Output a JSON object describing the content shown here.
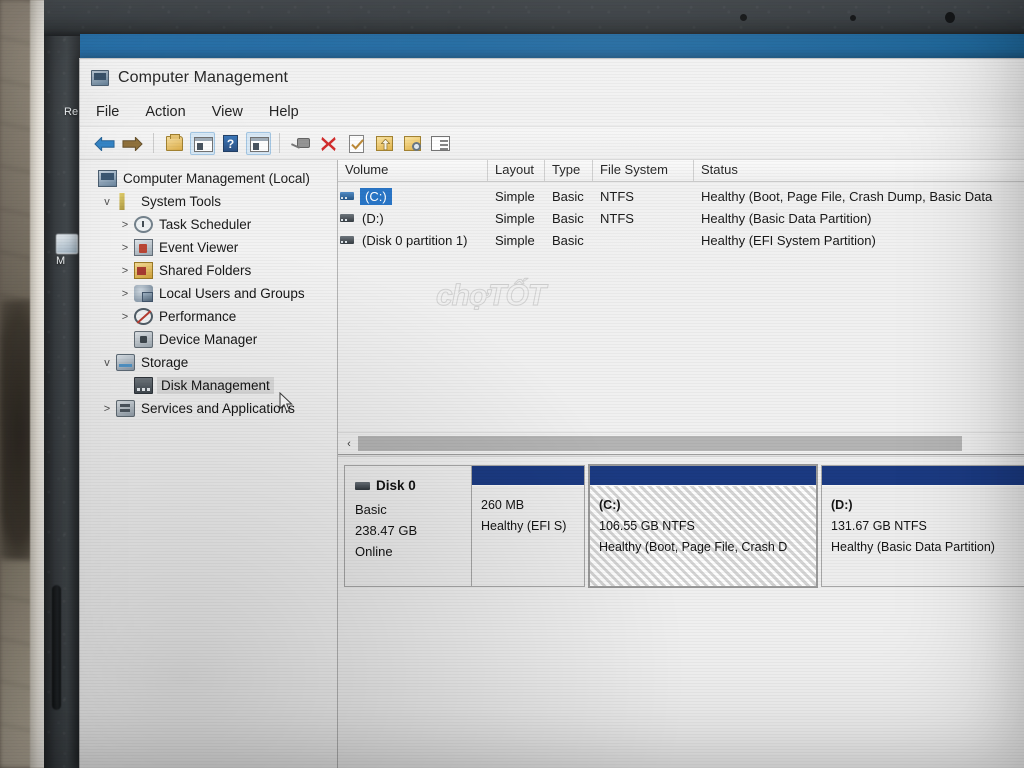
{
  "window": {
    "title": "Computer Management",
    "title_icon": "computer-icon"
  },
  "menu": {
    "items": [
      "File",
      "Action",
      "View",
      "Help"
    ]
  },
  "toolbar": {
    "buttons": [
      {
        "name": "back-icon",
        "label": "Back"
      },
      {
        "name": "forward-icon",
        "label": "Forward"
      },
      {
        "name": "up-one-level-icon",
        "label": "Up One Level"
      },
      {
        "name": "show-console-tree-icon",
        "label": "Show/Hide Console Tree"
      },
      {
        "name": "help-icon",
        "label": "Help"
      },
      {
        "name": "properties-icon",
        "label": "Properties"
      },
      {
        "name": "rescan-disks-icon",
        "label": "Rescan Disks"
      },
      {
        "name": "delete-icon",
        "label": "Delete"
      },
      {
        "name": "verify-icon",
        "label": "Verify"
      },
      {
        "name": "export-list-icon",
        "label": "Export List"
      },
      {
        "name": "find-icon",
        "label": "Find"
      },
      {
        "name": "list-view-icon",
        "label": "List View"
      }
    ]
  },
  "tree": {
    "items": [
      {
        "label": "Computer Management (Local)",
        "icon": "computer-icon",
        "indent": 0,
        "chevron": "",
        "selected": false
      },
      {
        "label": "System Tools",
        "icon": "tools-icon",
        "indent": 1,
        "chevron": "v",
        "selected": false
      },
      {
        "label": "Task Scheduler",
        "icon": "clock-icon",
        "indent": 2,
        "chevron": ">",
        "selected": false
      },
      {
        "label": "Event Viewer",
        "icon": "event-log-icon",
        "indent": 2,
        "chevron": ">",
        "selected": false
      },
      {
        "label": "Shared Folders",
        "icon": "shared-folder-icon",
        "indent": 2,
        "chevron": ">",
        "selected": false
      },
      {
        "label": "Local Users and Groups",
        "icon": "users-icon",
        "indent": 2,
        "chevron": ">",
        "selected": false
      },
      {
        "label": "Performance",
        "icon": "performance-icon",
        "indent": 2,
        "chevron": ">",
        "selected": false
      },
      {
        "label": "Device Manager",
        "icon": "device-manager-icon",
        "indent": 2,
        "chevron": "",
        "selected": false
      },
      {
        "label": "Storage",
        "icon": "storage-icon",
        "indent": 1,
        "chevron": "v",
        "selected": false
      },
      {
        "label": "Disk Management",
        "icon": "disk-icon",
        "indent": 2,
        "chevron": "",
        "selected": true
      },
      {
        "label": "Services and Applications",
        "icon": "services-icon",
        "indent": 1,
        "chevron": ">",
        "selected": false
      }
    ]
  },
  "volume_list": {
    "columns": [
      "Volume",
      "Layout",
      "Type",
      "File System",
      "Status"
    ],
    "rows": [
      {
        "volume": "(C:)",
        "layout": "Simple",
        "type": "Basic",
        "file_system": "NTFS",
        "status": "Healthy (Boot, Page File, Crash Dump, Basic Data",
        "selected": true,
        "icon": "volume-icon-blue"
      },
      {
        "volume": "(D:)",
        "layout": "Simple",
        "type": "Basic",
        "file_system": "NTFS",
        "status": "Healthy (Basic Data Partition)",
        "selected": false,
        "icon": "volume-icon"
      },
      {
        "volume": "(Disk 0 partition 1)",
        "layout": "Simple",
        "type": "Basic",
        "file_system": "",
        "status": "Healthy (EFI System Partition)",
        "selected": false,
        "icon": "volume-icon"
      }
    ]
  },
  "scrollbar": {
    "left_arrow": "‹"
  },
  "disk_graphic": {
    "disk": {
      "name": "Disk 0",
      "type": "Basic",
      "size": "238.47 GB",
      "state": "Online"
    },
    "partitions": [
      {
        "label": "",
        "size": "260 MB",
        "status": "Healthy (EFI S)",
        "selected": false
      },
      {
        "label": "(C:)",
        "size": "106.55 GB NTFS",
        "status": "Healthy (Boot, Page File, Crash D",
        "selected": true
      },
      {
        "label": "(D:)",
        "size": "131.67 GB NTFS",
        "status": "Healthy (Basic Data Partition)",
        "selected": false
      }
    ]
  },
  "watermark": {
    "text": "chợTỐT"
  },
  "desktop": {
    "icons": [
      {
        "label": "Re"
      },
      {
        "label": "M"
      }
    ]
  },
  "colors": {
    "selection_blue": "#1f6fc4",
    "partition_bar": "#1b3a82",
    "desktop_blue": "#1a6aa6",
    "window_chrome": "#f0f0f0"
  }
}
